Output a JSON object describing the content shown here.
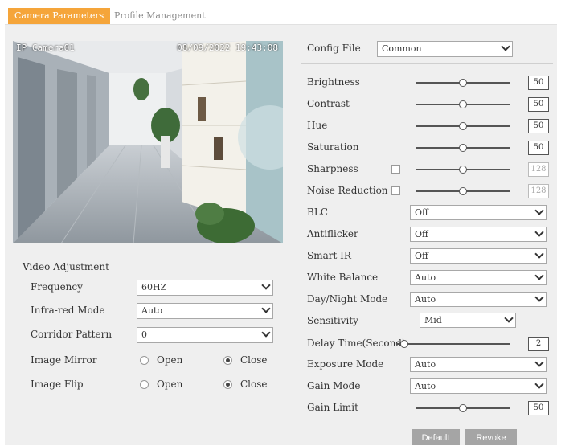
{
  "tabs": [
    {
      "label": "Camera Parameters",
      "active": true
    },
    {
      "label": "Profile Management",
      "active": false
    }
  ],
  "video": {
    "camera_name": "IP Camera01",
    "timestamp": "08/09/2022 19:43:08"
  },
  "video_adjustment": {
    "title": "Video Adjustment",
    "frequency": {
      "label": "Frequency",
      "value": "60HZ"
    },
    "infrared_mode": {
      "label": "Infra-red Mode",
      "value": "Auto"
    },
    "corridor_pattern": {
      "label": "Corridor Pattern",
      "value": "0"
    },
    "image_mirror": {
      "label": "Image Mirror",
      "open_label": "Open",
      "close_label": "Close",
      "selected": "Close"
    },
    "image_flip": {
      "label": "Image Flip",
      "open_label": "Open",
      "close_label": "Close",
      "selected": "Close"
    }
  },
  "config_file": {
    "label": "Config File",
    "value": "Common"
  },
  "sliders": {
    "brightness": {
      "label": "Brightness",
      "value": "50"
    },
    "contrast": {
      "label": "Contrast",
      "value": "50"
    },
    "hue": {
      "label": "Hue",
      "value": "50"
    },
    "saturation": {
      "label": "Saturation",
      "value": "50"
    },
    "sharpness": {
      "label": "Sharpness",
      "value": "128"
    },
    "noise_reduction": {
      "label": "Noise Reduction",
      "value": "128"
    },
    "delay_time": {
      "label": "Delay Time(Second)",
      "value": "2"
    },
    "gain_limit": {
      "label": "Gain Limit",
      "value": "50"
    }
  },
  "selects": {
    "blc": {
      "label": "BLC",
      "value": "Off"
    },
    "antiflicker": {
      "label": "Antiflicker",
      "value": "Off"
    },
    "smart_ir": {
      "label": "Smart IR",
      "value": "Off"
    },
    "white_balance": {
      "label": "White Balance",
      "value": "Auto"
    },
    "day_night_mode": {
      "label": "Day/Night Mode",
      "value": "Auto"
    },
    "sensitivity": {
      "label": "Sensitivity",
      "value": "Mid"
    },
    "exposure_mode": {
      "label": "Exposure Mode",
      "value": "Auto"
    },
    "gain_mode": {
      "label": "Gain Mode",
      "value": "Auto"
    }
  },
  "buttons": {
    "default_label": "Default",
    "revoke_label": "Revoke"
  },
  "colors": {
    "active_tab": "#f5a53a",
    "panel_bg": "#efefef",
    "button_bg": "#a5a5a5"
  }
}
